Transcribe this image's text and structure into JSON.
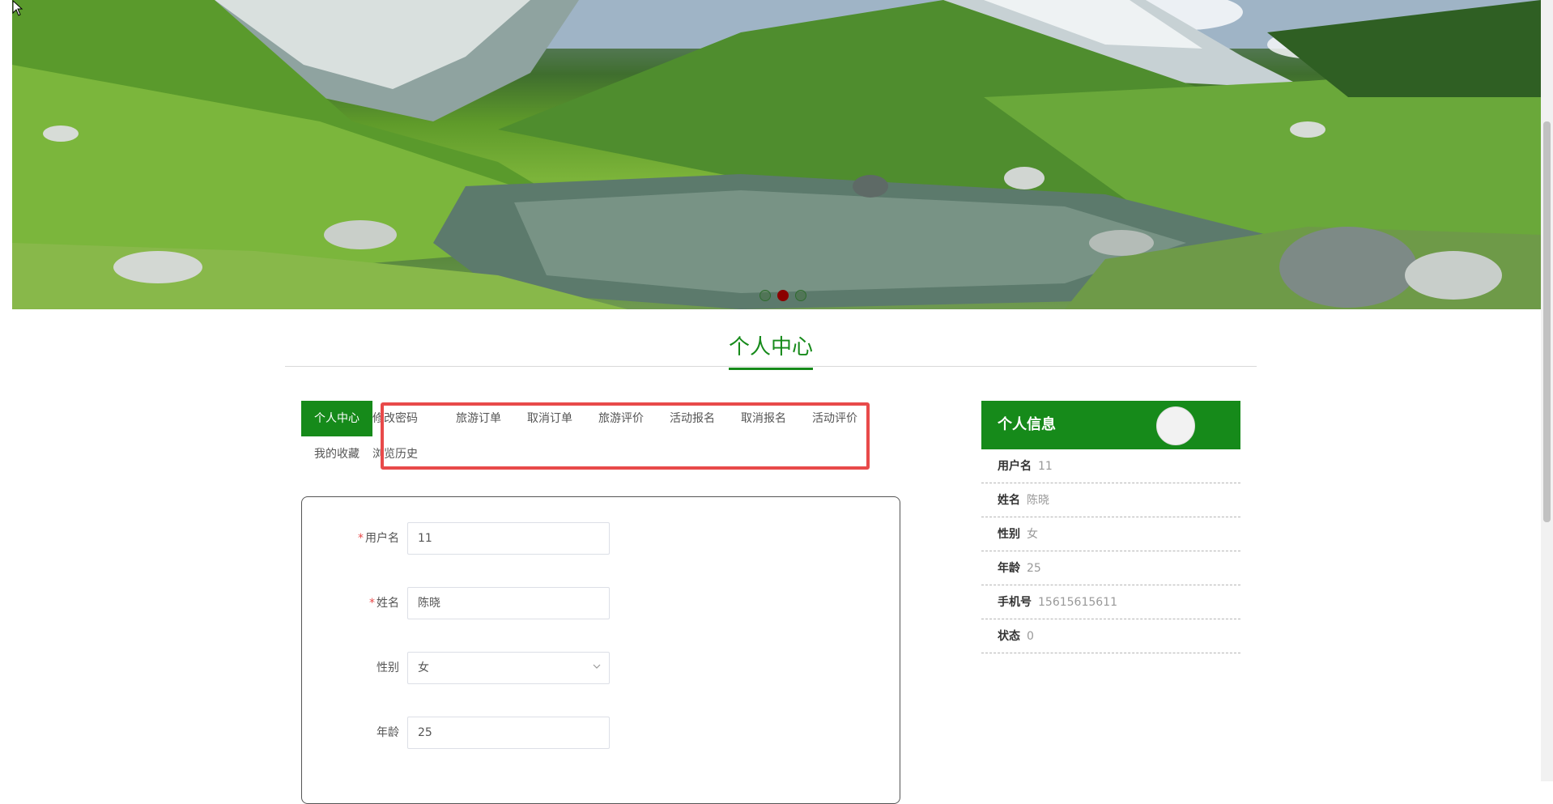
{
  "banner": {
    "dots": [
      {
        "active": false
      },
      {
        "active": true
      },
      {
        "active": false
      }
    ]
  },
  "section": {
    "title": "个人中心"
  },
  "tabs": [
    {
      "label": "个人中心",
      "active": true
    },
    {
      "label": "修改密码",
      "active": false
    },
    {
      "label": "旅游订单",
      "active": false
    },
    {
      "label": "取消订单",
      "active": false
    },
    {
      "label": "旅游评价",
      "active": false
    },
    {
      "label": "活动报名",
      "active": false
    },
    {
      "label": "取消报名",
      "active": false
    },
    {
      "label": "活动评价",
      "active": false
    },
    {
      "label": "我的收藏",
      "active": false
    },
    {
      "label": "浏览历史",
      "active": false
    }
  ],
  "form": {
    "username": {
      "label": "用户名",
      "required": true,
      "value": "11"
    },
    "name": {
      "label": "姓名",
      "required": true,
      "value": "陈晓"
    },
    "gender": {
      "label": "性别",
      "required": false,
      "value": "女"
    },
    "age": {
      "label": "年龄",
      "required": false,
      "value": "25"
    }
  },
  "info": {
    "title": "个人信息",
    "rows": [
      {
        "key": "用户名",
        "value": "11"
      },
      {
        "key": "姓名",
        "value": "陈晓"
      },
      {
        "key": "性别",
        "value": "女"
      },
      {
        "key": "年龄",
        "value": "25"
      },
      {
        "key": "手机号",
        "value": "15615615611"
      },
      {
        "key": "状态",
        "value": "0"
      }
    ]
  },
  "colors": {
    "accent": "#168a1a",
    "highlight": "#e84a4a"
  }
}
